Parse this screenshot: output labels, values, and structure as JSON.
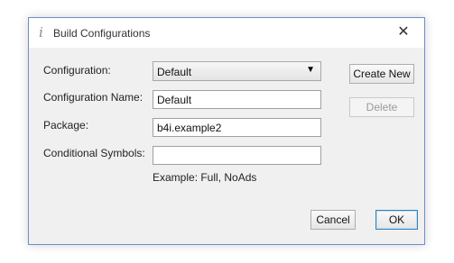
{
  "window": {
    "title": "Build Configurations",
    "title_icon": "i"
  },
  "icons": {
    "title_icon": "info-icon",
    "close": "close-icon",
    "dropdown": "chevron-down-icon"
  },
  "titlebar": {
    "close_glyph": "✕"
  },
  "form": {
    "configuration_label": "Configuration:",
    "configuration_value": "Default",
    "dropdown_glyph": "▼",
    "configuration_name_label": "Configuration Name:",
    "configuration_name_value": "Default",
    "package_label": "Package:",
    "package_value": "b4i.example2",
    "conditional_symbols_label": "Conditional Symbols:",
    "conditional_symbols_value": "",
    "example_text": "Example: Full, NoAds"
  },
  "buttons": {
    "create_new": "Create New",
    "delete": "Delete",
    "cancel": "Cancel",
    "ok": "OK"
  }
}
